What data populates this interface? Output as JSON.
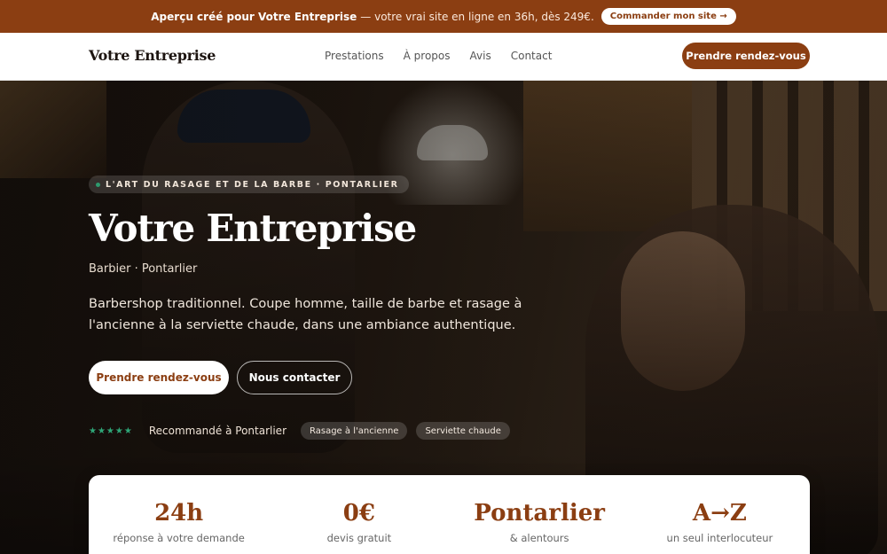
{
  "promo": {
    "strong": "Aperçu créé pour Votre Entreprise",
    "rest": "— votre vrai site en ligne en 36h, dès 249€.",
    "button": "Commander mon site →"
  },
  "nav": {
    "brand": "Votre Entreprise",
    "links": [
      "Prestations",
      "À propos",
      "Avis",
      "Contact"
    ],
    "cta": "Prendre rendez-vous"
  },
  "hero": {
    "eyebrow": "L'ART DU RASAGE ET DE LA BARBE · PONTARLIER",
    "title": "Votre Entreprise",
    "subtitle": "Barbier · Pontarlier",
    "description": "Barbershop traditionnel. Coupe homme, taille de barbe et rasage à l'ancienne à la serviette chaude, dans une ambiance authentique.",
    "primary_button": "Prendre rendez-vous",
    "secondary_button": "Nous contacter",
    "stars": "★★★★★",
    "rating_value": 5,
    "trust_text": "Recommandé à Pontarlier",
    "tags": [
      "Rasage à l'ancienne",
      "Serviette chaude"
    ]
  },
  "stats": [
    {
      "value": "24h",
      "label": "réponse à votre demande"
    },
    {
      "value": "0€",
      "label": "devis gratuit"
    },
    {
      "value": "Pontarlier",
      "label": "& alentours"
    },
    {
      "value": "A→Z",
      "label": "un seul interlocuteur"
    }
  ],
  "colors": {
    "accent": "#8b3e12",
    "star": "#2fa678",
    "hero_dark": "#1b1410"
  }
}
